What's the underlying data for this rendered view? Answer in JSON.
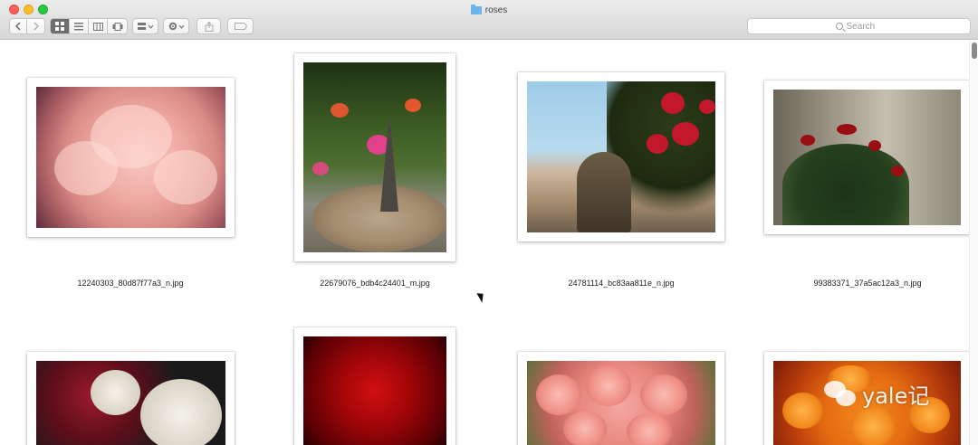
{
  "window": {
    "title": "roses",
    "title_icon": "folder-icon"
  },
  "toolbar": {
    "back_icon": "chevron-left-icon",
    "forward_icon": "chevron-right-icon",
    "view_modes": [
      "icon-view",
      "list-view",
      "column-view",
      "cover-flow-view"
    ],
    "active_view": "icon-view",
    "arrange_icon": "arrange-icon",
    "action_icon": "gear-icon",
    "share_icon": "share-icon",
    "tag_icon": "tag-icon",
    "search_placeholder": "Search"
  },
  "files": [
    {
      "name": "12240303_80d87f77a3_n.jpg"
    },
    {
      "name": "22679076_bdb4c24401_m.jpg"
    },
    {
      "name": "24781114_bc83aa811e_n.jpg"
    },
    {
      "name": "99383371_37a5ac12a3_n.jpg"
    },
    {
      "name": ""
    },
    {
      "name": ""
    },
    {
      "name": ""
    },
    {
      "name": ""
    }
  ],
  "watermark": {
    "text": "yale记"
  },
  "colors": {
    "close": "#fc5f57",
    "minimize": "#fdbc2e",
    "maximize": "#28c840",
    "folder": "#6bb4ea"
  }
}
